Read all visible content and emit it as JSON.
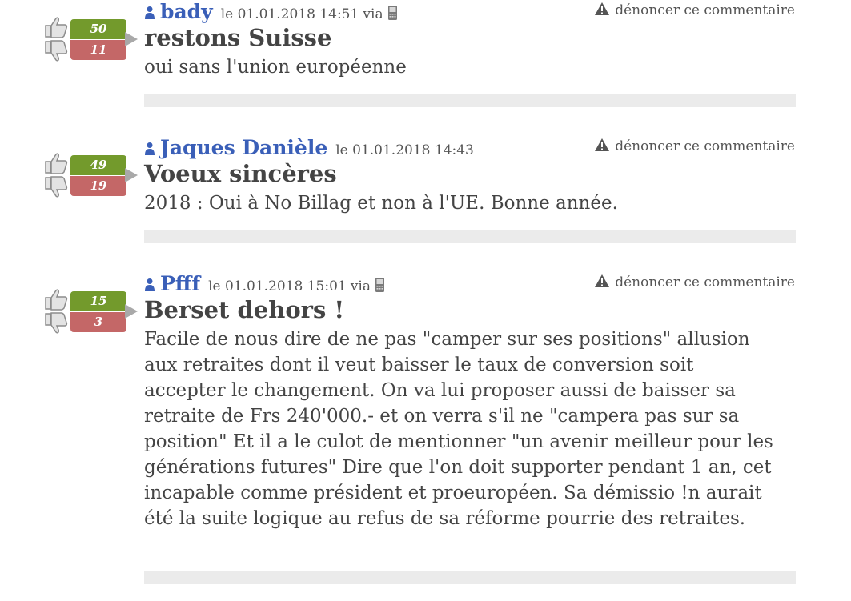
{
  "comments": [
    {
      "author": "bady",
      "date": "le 01.01.2018 14:51",
      "via": "via",
      "has_mobile": true,
      "likes": "50",
      "dislikes": "11",
      "report": "dénoncer ce commentaire",
      "title": "restons Suisse",
      "body": "oui sans l'union européenne"
    },
    {
      "author": "Jaques Danièle",
      "date": "le 01.01.2018 14:43",
      "via": "",
      "has_mobile": false,
      "likes": "49",
      "dislikes": "19",
      "report": "dénoncer ce commentaire",
      "title": "Voeux sincères",
      "body": "2018 : Oui à No Billag et non à l'UE. Bonne année."
    },
    {
      "author": "Pfff",
      "date": "le 01.01.2018 15:01",
      "via": "via",
      "has_mobile": true,
      "likes": "15",
      "dislikes": "3",
      "report": "dénoncer ce commentaire",
      "title": "Berset dehors !",
      "body": "Facile de nous dire de ne pas \"camper sur ses positions\" allusion aux retraites dont il veut baisser le taux de conversion soit accepter le changement. On va lui proposer aussi de baisser sa retraite de Frs 240'000.- et on verra s'il ne \"campera pas sur sa position\" Et il a le culot de mentionner \"un avenir meilleur pour les générations futures\" Dire que l'on doit supporter pendant 1 an, cet incapable comme président et proeuropéen. Sa démissio !n aurait été la suite logique au refus de sa réforme pourrie des retraites."
    }
  ],
  "colors": {
    "author": "#3a5fb8",
    "like": "#739a2c",
    "dislike": "#c46767",
    "text": "#444444",
    "separator": "#ebebeb"
  },
  "icons": [
    "user-icon",
    "mobile-phone-icon",
    "warning-icon",
    "thumbs-up-icon",
    "thumbs-down-icon"
  ]
}
